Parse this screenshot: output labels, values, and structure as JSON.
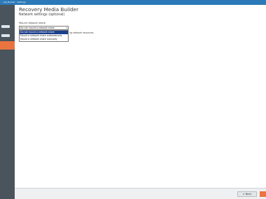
{
  "window": {
    "title": "...dia_Builder - Settings"
  },
  "sidebar": {
    "items": [
      {
        "label": ""
      },
      {
        "label": ""
      }
    ],
    "accent": "#e97440"
  },
  "main": {
    "app_title": "Recovery Media Builder",
    "section_title": "Network settings (optional)",
    "field_label": "Mount network share",
    "select": {
      "value": "Do not mount a network share",
      "options": [
        "Do not mount a network share",
        "Mount a network share automatically",
        "Mount a network share manually"
      ]
    },
    "partial_text": "ng network resources."
  },
  "footer": {
    "back_label": "< Back",
    "next_label": ""
  },
  "colors": {
    "titlebar": "#2b79b8",
    "sidebar": "#4a545c",
    "accent": "#e97440",
    "selection": "#1a3f8f"
  }
}
